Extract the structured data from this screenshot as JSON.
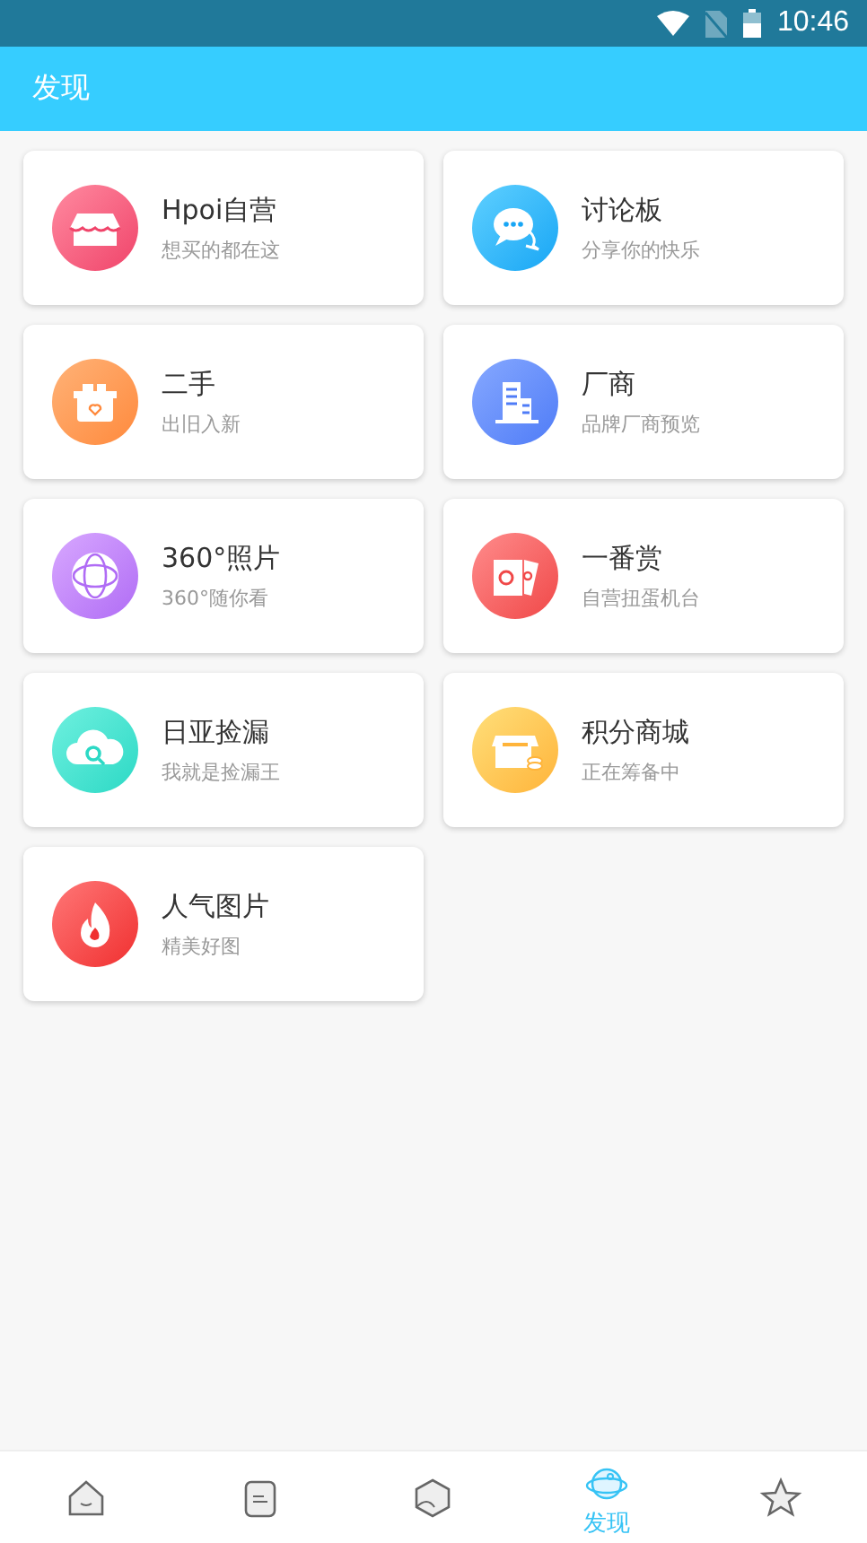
{
  "status_bar": {
    "time": "10:46"
  },
  "app_bar": {
    "title": "发现"
  },
  "cards": [
    {
      "kind": "shop",
      "title": "Hpoi自营",
      "subtitle": "想买的都在这"
    },
    {
      "kind": "chat",
      "title": "讨论板",
      "subtitle": "分享你的快乐"
    },
    {
      "kind": "box",
      "title": "二手",
      "subtitle": "出旧入新"
    },
    {
      "kind": "building",
      "title": "厂商",
      "subtitle": "品牌厂商预览"
    },
    {
      "kind": "globe",
      "title": "360°照片",
      "subtitle": "360°随你看"
    },
    {
      "kind": "tickets",
      "title": "一番赏",
      "subtitle": "自营扭蛋机台"
    },
    {
      "kind": "cloud",
      "title": "日亚捡漏",
      "subtitle": "我就是捡漏王"
    },
    {
      "kind": "store",
      "title": "积分商城",
      "subtitle": "正在筹备中"
    },
    {
      "kind": "flame",
      "title": "人气图片",
      "subtitle": "精美好图"
    }
  ],
  "bottom_nav": [
    {
      "kind": "home",
      "selected": false
    },
    {
      "kind": "note",
      "selected": false
    },
    {
      "kind": "cube",
      "selected": false
    },
    {
      "kind": "planet",
      "selected": true,
      "label": "发现"
    },
    {
      "kind": "star",
      "selected": false
    }
  ]
}
